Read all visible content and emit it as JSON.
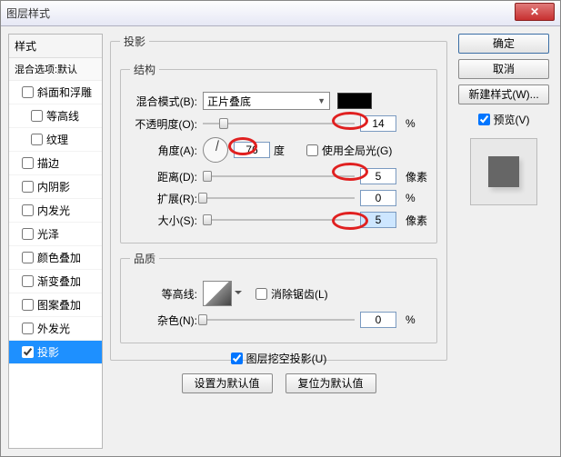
{
  "window": {
    "title": "图层样式"
  },
  "sidebar": {
    "header": "样式",
    "sub": "混合选项:默认",
    "items": [
      {
        "label": "斜面和浮雕"
      },
      {
        "label": "等高线"
      },
      {
        "label": "纹理"
      },
      {
        "label": "描边"
      },
      {
        "label": "内阴影"
      },
      {
        "label": "内发光"
      },
      {
        "label": "光泽"
      },
      {
        "label": "颜色叠加"
      },
      {
        "label": "渐变叠加"
      },
      {
        "label": "图案叠加"
      },
      {
        "label": "外发光"
      },
      {
        "label": "投影"
      }
    ]
  },
  "main": {
    "group_title": "投影",
    "structure": {
      "legend": "结构",
      "blend_mode_label": "混合模式(B):",
      "blend_mode_value": "正片叠底",
      "opacity_label": "不透明度(O):",
      "opacity_value": "14",
      "opacity_unit": "%",
      "angle_label": "角度(A):",
      "angle_value": "76",
      "angle_unit": "度",
      "global_light_label": "使用全局光(G)",
      "distance_label": "距离(D):",
      "distance_value": "5",
      "distance_unit": "像素",
      "spread_label": "扩展(R):",
      "spread_value": "0",
      "spread_unit": "%",
      "size_label": "大小(S):",
      "size_value": "5",
      "size_unit": "像素"
    },
    "quality": {
      "legend": "品质",
      "contour_label": "等高线:",
      "antialias_label": "消除锯齿(L)",
      "noise_label": "杂色(N):",
      "noise_value": "0",
      "noise_unit": "%"
    },
    "knockout_label": "图层挖空投影(U)",
    "btn_default": "设置为默认值",
    "btn_reset": "复位为默认值"
  },
  "right": {
    "ok": "确定",
    "cancel": "取消",
    "newstyle": "新建样式(W)...",
    "preview_label": "预览(V)"
  }
}
